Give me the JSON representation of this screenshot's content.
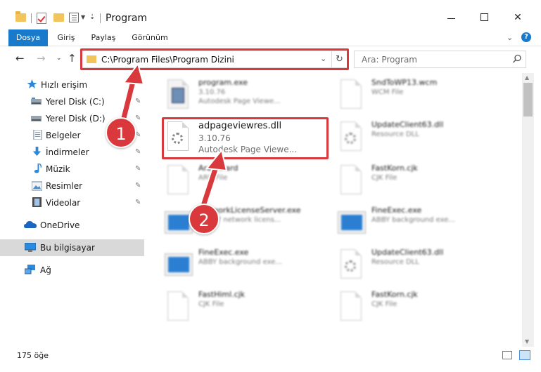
{
  "window": {
    "title": "Program",
    "close_glyph": "✕"
  },
  "ribbon": {
    "tabs": [
      {
        "label": "Dosya",
        "active": true
      },
      {
        "label": "Giriş"
      },
      {
        "label": "Paylaş"
      },
      {
        "label": "Görünüm"
      }
    ],
    "help_glyph": "?"
  },
  "address": {
    "path": "C:\\Program Files\\Program Dizini",
    "refresh_glyph": "↻"
  },
  "search": {
    "placeholder": "Ara: Program"
  },
  "sidebar": {
    "items": [
      {
        "label": "Hızlı erişim",
        "icon": "star-icon"
      },
      {
        "label": "Yerel Disk (C:)",
        "icon": "drive-icon",
        "pinned": true
      },
      {
        "label": "Yerel Disk (D:)",
        "icon": "drive-icon",
        "pinned": true
      },
      {
        "label": "Belgeler",
        "icon": "documents-icon",
        "pinned": true
      },
      {
        "label": "İndirmeler",
        "icon": "download-icon",
        "pinned": true
      },
      {
        "label": "Müzik",
        "icon": "music-icon",
        "pinned": true
      },
      {
        "label": "Resimler",
        "icon": "pictures-icon",
        "pinned": true
      },
      {
        "label": "Videolar",
        "icon": "videos-icon",
        "pinned": true
      },
      {
        "label": "OneDrive",
        "icon": "cloud-icon"
      },
      {
        "label": "Bu bilgisayar",
        "icon": "computer-icon",
        "selected": true
      },
      {
        "label": "Ağ",
        "icon": "network-icon"
      }
    ],
    "pin_glyph": "📌"
  },
  "files": [
    {
      "name": "program.exe",
      "line2": "3.10.76",
      "line3": "Autodesk Page Viewe...",
      "icon": "exe"
    },
    {
      "name": "SndToWP13.wcm",
      "line2": "WCM File",
      "line3": "",
      "icon": "doc"
    },
    {
      "name": "adpageviewres.dll",
      "line2": "3.10.76",
      "line3": "Autodesk Page Viewe...",
      "icon": "dll"
    },
    {
      "name": "UpdateClient63.dll",
      "line2": "Resource DLL",
      "line3": "",
      "icon": "dll"
    },
    {
      "name": "Arabic.ard",
      "line2": "ARD File",
      "line3": "",
      "icon": "doc"
    },
    {
      "name": "FastKorn.cjk",
      "line2": "CJK File",
      "line3": "",
      "icon": "doc"
    },
    {
      "name": "NetworkLicenseServer.exe",
      "line2": "ABBYY network licens...",
      "line3": "",
      "icon": "win"
    },
    {
      "name": "FineExec.exe",
      "line2": "ABBY background exe...",
      "line3": "",
      "icon": "win"
    },
    {
      "name": "FineExec.exe",
      "line2": "ABBY background exe...",
      "line3": "",
      "icon": "win"
    },
    {
      "name": "UpdateClient63.dll",
      "line2": "Resource DLL",
      "line3": "",
      "icon": "dll"
    },
    {
      "name": "FastHiml.cjk",
      "line2": "CJK File",
      "line3": "",
      "icon": "doc"
    },
    {
      "name": "FastKorn.cjk",
      "line2": "CJK File",
      "line3": "",
      "icon": "doc"
    }
  ],
  "status": {
    "count_text": "175 öğe"
  },
  "annotations": {
    "badge1": "1",
    "badge2": "2",
    "color": "#d9393c"
  }
}
